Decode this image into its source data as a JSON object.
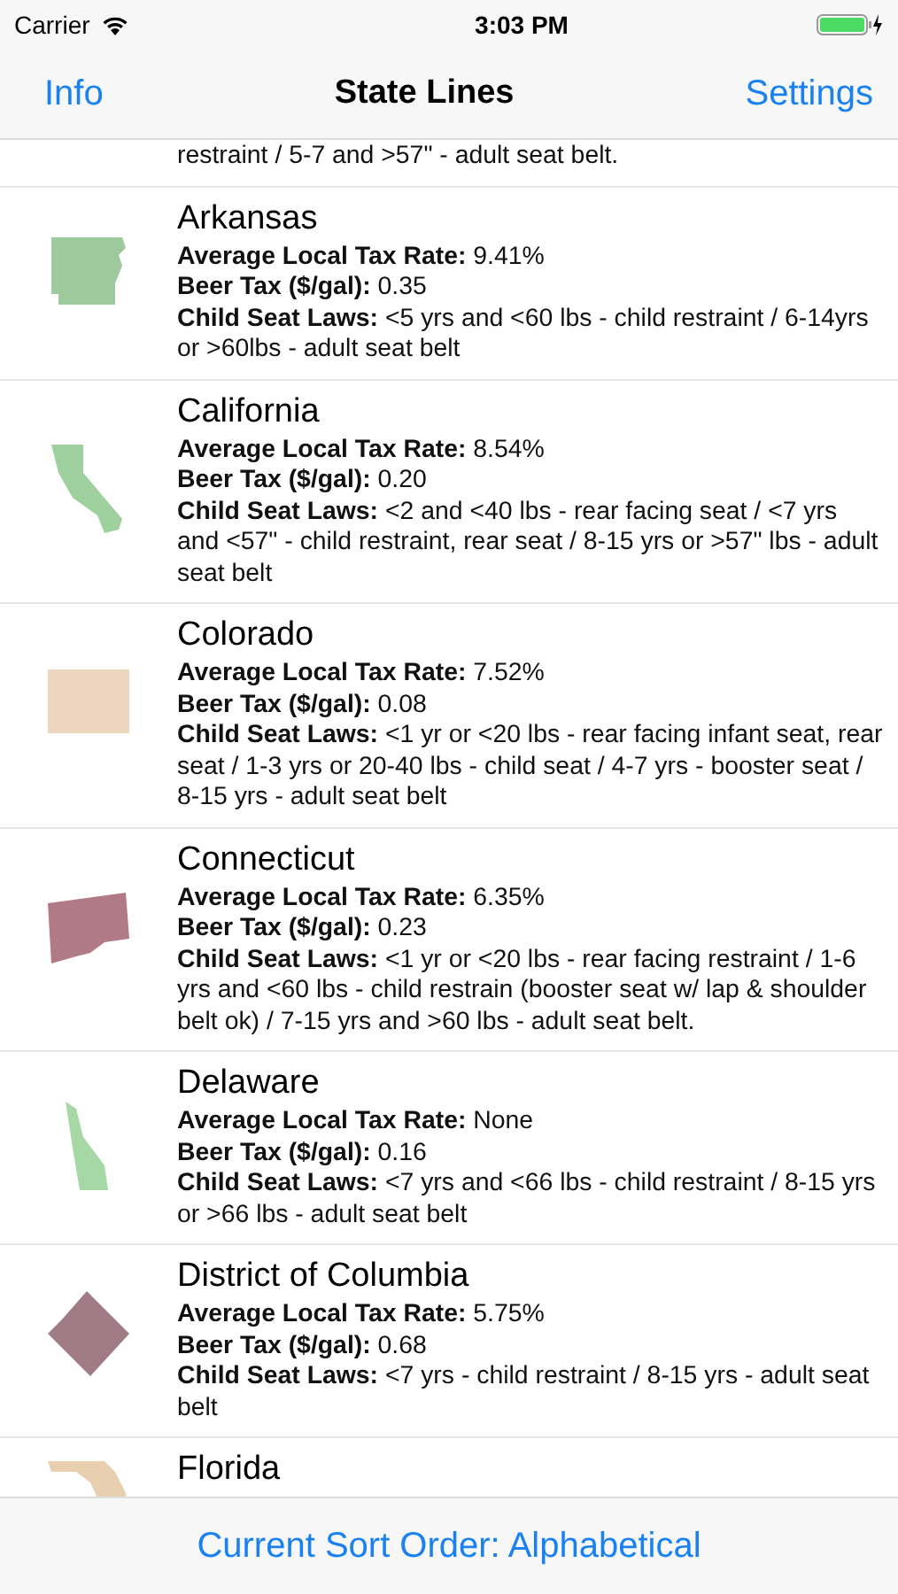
{
  "status_bar": {
    "carrier": "Carrier",
    "time": "3:03 PM"
  },
  "nav": {
    "left": "Info",
    "title": "State Lines",
    "right": "Settings"
  },
  "partial_row": {
    "text": "restraint / 5-7 and >57\" - adult seat belt."
  },
  "states": [
    {
      "name": "Arkansas",
      "color": "#9dc99d",
      "lines": [
        "**Average Local Tax Rate:** 9.41%",
        "**Beer Tax ($/gal):** 0.35",
        "**Child Seat Laws:** <5 yrs and <60 lbs - child restraint / 6-14yrs or >60lbs - adult seat belt"
      ]
    },
    {
      "name": "California",
      "color": "#9fd19f",
      "lines": [
        "**Average Local Tax Rate:** 8.54%",
        "**Beer Tax ($/gal):** 0.20",
        "**Child Seat Laws:** <2 and <40 lbs - rear facing seat / <7 yrs and <57\" - child restraint, rear seat / 8-15 yrs or >57\" lbs - adult seat belt"
      ]
    },
    {
      "name": "Colorado",
      "color": "#ecd6c0",
      "lines": [
        "**Average Local Tax Rate:** 7.52%",
        "**Beer Tax ($/gal):** 0.08",
        "**Child Seat Laws:** <1 yr or <20 lbs - rear facing infant seat, rear seat / 1-3 yrs or 20-40 lbs - child seat / 4-7 yrs - booster seat / 8-15 yrs - adult seat belt"
      ]
    },
    {
      "name": "Connecticut",
      "color": "#b07b86",
      "lines": [
        "**Average Local Tax Rate:** 6.35%",
        "**Beer Tax ($/gal):** 0.23",
        "**Child Seat Laws:** <1 yr or <20 lbs - rear facing restraint / 1-6 yrs and <60 lbs - child restrain (booster seat w/ lap & shoulder belt ok) / 7-15 yrs and >60 lbs - adult seat belt."
      ]
    },
    {
      "name": "Delaware",
      "color": "#a6d8a6",
      "lines": [
        "**Average Local Tax Rate:** None",
        "**Beer Tax ($/gal):** 0.16",
        "**Child Seat Laws:** <7 yrs and <66 lbs - child restraint / 8-15 yrs or >66 lbs - adult seat belt"
      ]
    },
    {
      "name": "District of Columbia",
      "color": "#a07b86",
      "lines": [
        "**Average Local Tax Rate:** 5.75%",
        "**Beer Tax ($/gal):** 0.68",
        "**Child Seat Laws:** <7 yrs - child restraint / 8-15 yrs - adult seat belt"
      ]
    },
    {
      "name": "Florida",
      "color": "#e8cfb0"
    }
  ],
  "bottom_bar": {
    "label": "Current Sort Order: Alphabetical"
  }
}
